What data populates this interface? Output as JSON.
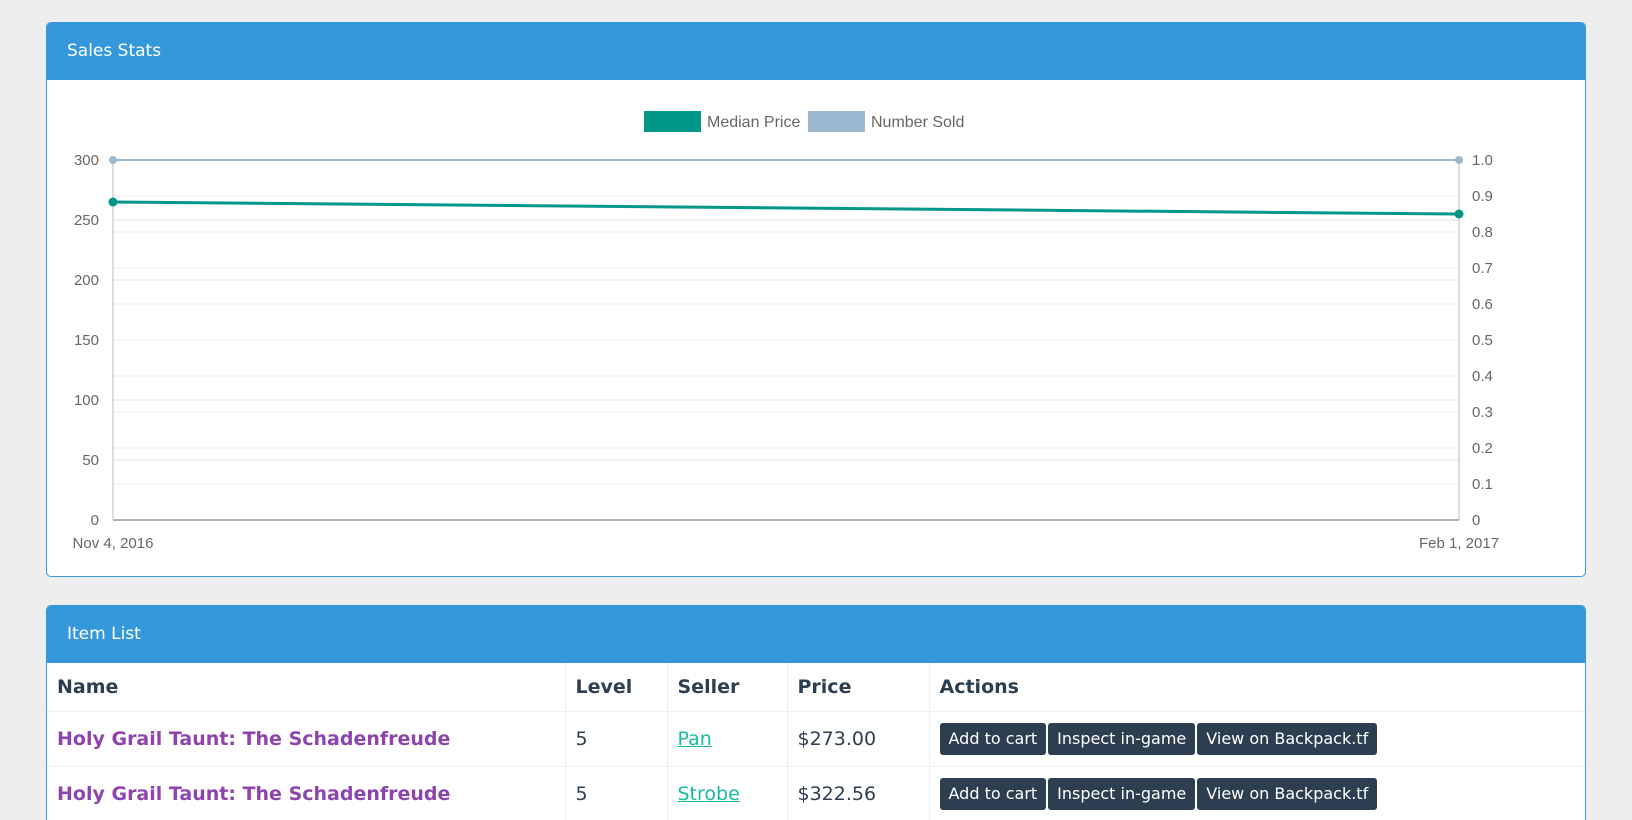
{
  "sales_stats": {
    "title": "Sales Stats"
  },
  "chart_data": {
    "type": "line",
    "x": [
      "Nov 4, 2016",
      "Feb 1, 2017"
    ],
    "x_tick_labels": [
      "Nov 4, 2016",
      "Feb 1, 2017"
    ],
    "series": [
      {
        "name": "Median Price",
        "axis": "left",
        "values": [
          265,
          255
        ],
        "color": "#009688"
      },
      {
        "name": "Number Sold",
        "axis": "right",
        "values": [
          1.0,
          1.0
        ],
        "color": "#9ab9d0"
      }
    ],
    "y_left": {
      "ylim": [
        0,
        300
      ],
      "ticks": [
        "0",
        "50",
        "100",
        "150",
        "200",
        "250",
        "300"
      ]
    },
    "y_right": {
      "ylim": [
        0,
        1.0
      ],
      "ticks": [
        "0",
        "0.1",
        "0.2",
        "0.3",
        "0.4",
        "0.5",
        "0.6",
        "0.7",
        "0.8",
        "0.9",
        "1.0"
      ]
    },
    "legend_position": "top",
    "grid": true
  },
  "item_list": {
    "title": "Item List",
    "columns": [
      "Name",
      "Level",
      "Seller",
      "Price",
      "Actions"
    ],
    "rows": [
      {
        "name": "Holy Grail Taunt: The Schadenfreude",
        "level": "5",
        "seller": "Pan",
        "price": "$273.00"
      },
      {
        "name": "Holy Grail Taunt: The Schadenfreude",
        "level": "5",
        "seller": "Strobe",
        "price": "$322.56"
      }
    ],
    "actions": {
      "add_to_cart": "Add to cart",
      "inspect": "Inspect in-game",
      "backpack": "View on Backpack.tf"
    }
  },
  "colors": {
    "panel_header": "#3498db",
    "item_link": "#8e44ad",
    "seller_link": "#18bc9c",
    "button": "#2c3e50"
  }
}
